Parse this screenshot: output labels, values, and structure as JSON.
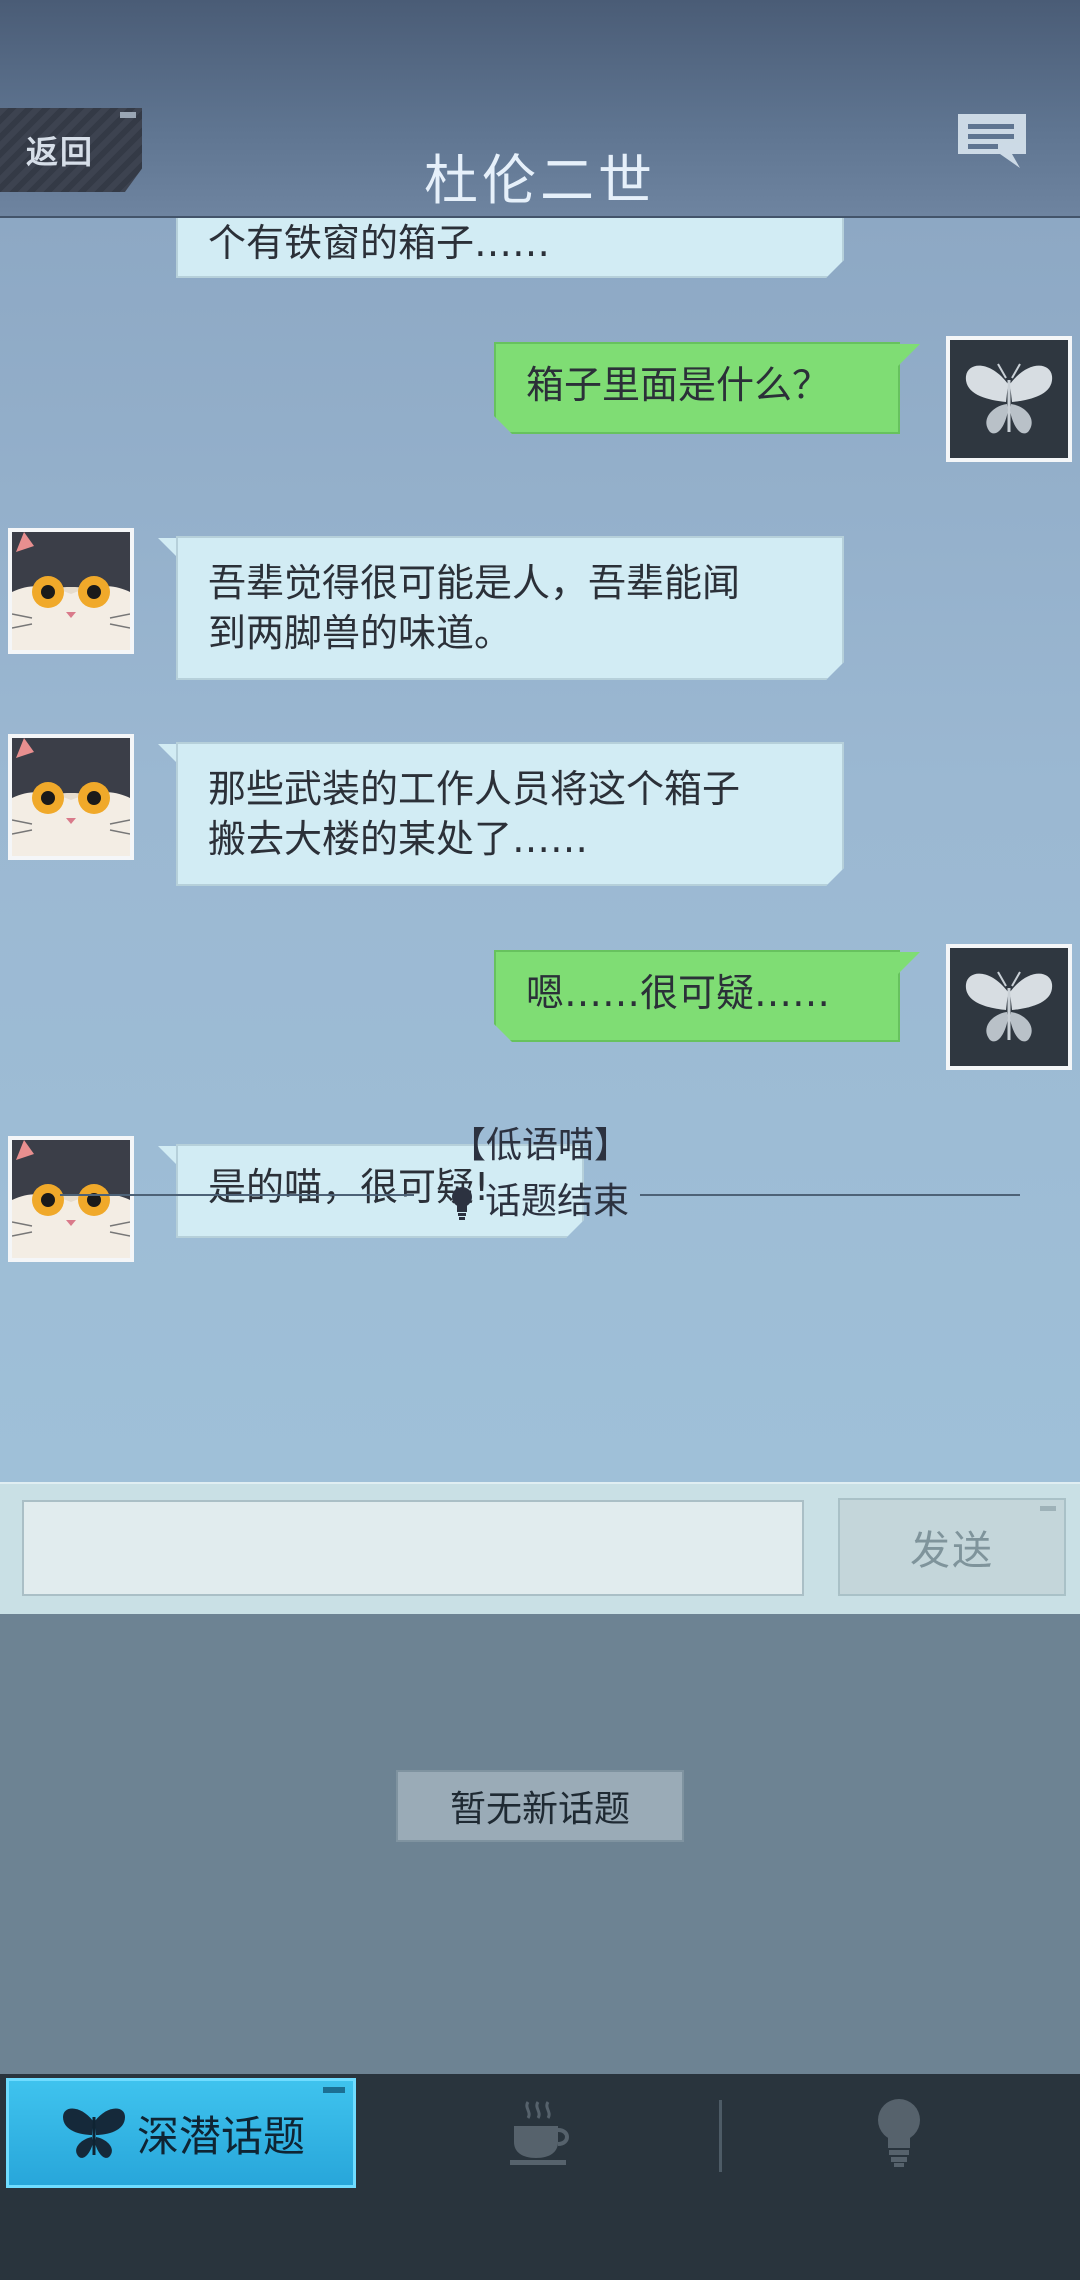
{
  "header": {
    "back_label": "返回",
    "title": "杜伦二世",
    "chat_icon": "message-list-icon"
  },
  "messages": [
    {
      "side": "left",
      "avatar": "cat-avatar",
      "text": "个有铁窗的箱子……"
    },
    {
      "side": "right",
      "avatar": "butterfly-avatar",
      "text": "箱子里面是什么？"
    },
    {
      "side": "left",
      "avatar": "cat-avatar",
      "lines": [
        "吾辈觉得很可能是人，吾辈能闻",
        "到两脚兽的味道。"
      ]
    },
    {
      "side": "left",
      "avatar": "cat-avatar",
      "lines": [
        "那些武装的工作人员将这个箱子",
        "搬去大楼的某处了……"
      ]
    },
    {
      "side": "right",
      "avatar": "butterfly-avatar",
      "text": "嗯……很可疑……"
    },
    {
      "side": "left",
      "avatar": "cat-avatar",
      "text": "是的喵，很可疑!"
    }
  ],
  "system": {
    "speaker": "【低语喵】",
    "topic_end": "话题结束"
  },
  "input": {
    "placeholder": "",
    "send_label": "发送"
  },
  "topic_panel": {
    "no_topic_label": "暂无新话题"
  },
  "tabs": [
    {
      "label": "深潜话题",
      "icon": "butterfly-icon",
      "active": true
    },
    {
      "label": "",
      "icon": "coffee-cup-icon",
      "active": false
    },
    {
      "label": "",
      "icon": "lightbulb-icon",
      "active": false
    }
  ],
  "colors": {
    "header": "#5f7591",
    "bubble_left": "#d2ecf4",
    "bubble_right": "#7fdd74",
    "tab_active": "#3fc3ee",
    "panel": "#6d8393"
  }
}
